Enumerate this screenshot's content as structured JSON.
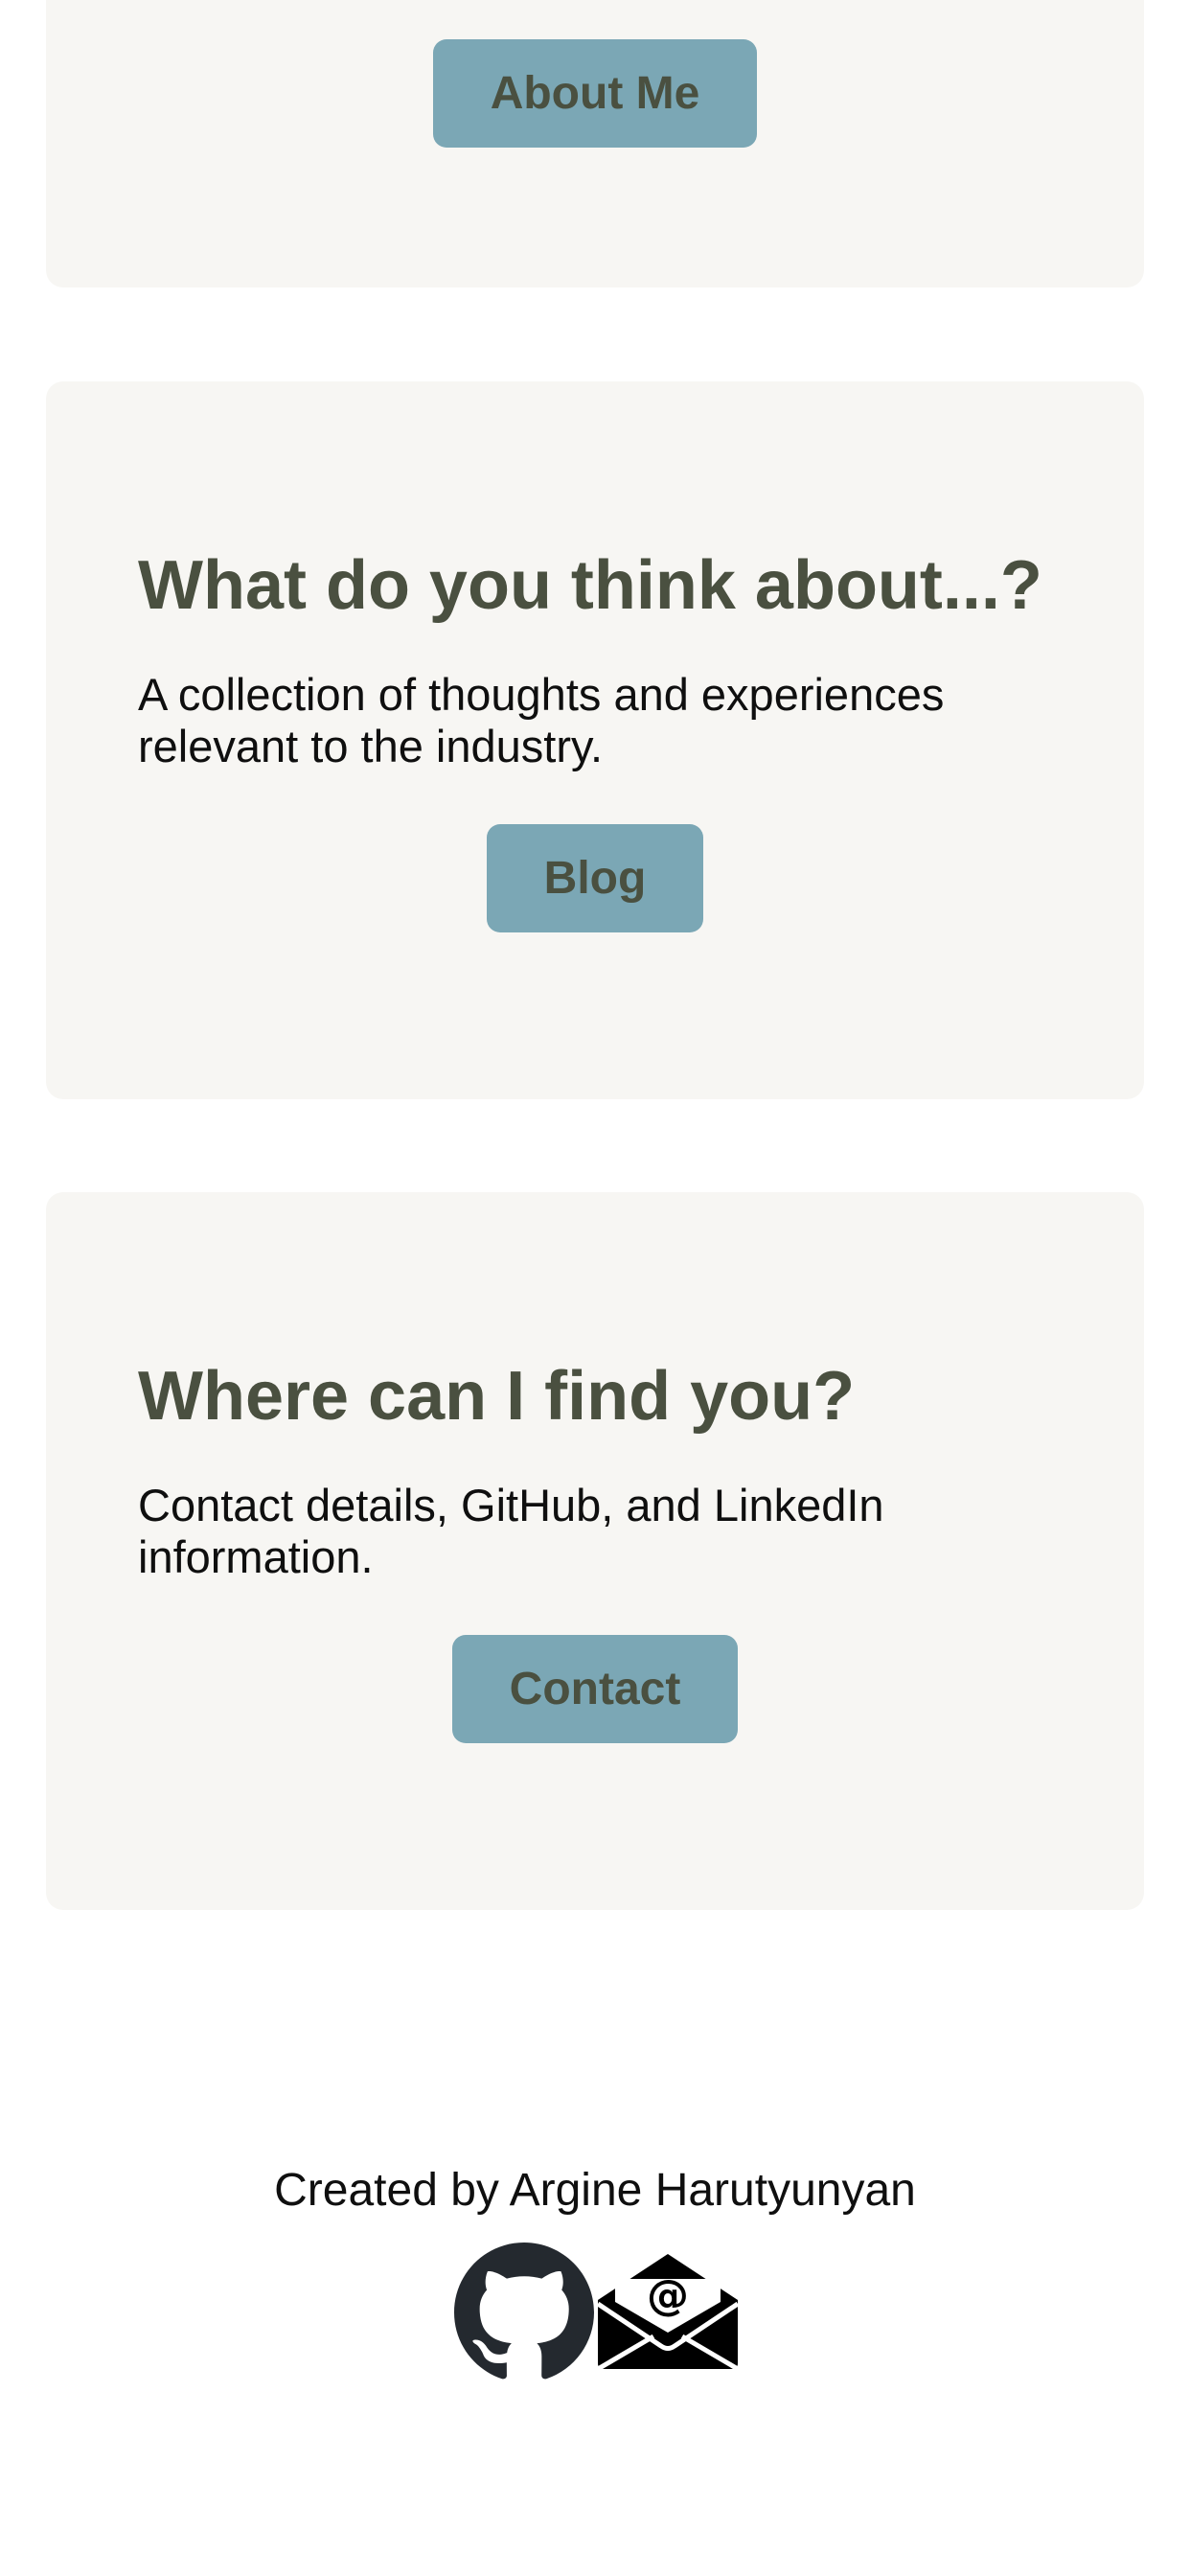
{
  "cards": {
    "about": {
      "button_label": "About Me"
    },
    "blog": {
      "title": "What do you think about...?",
      "description": "A collection of thoughts and experiences relevant to the industry.",
      "button_label": "Blog"
    },
    "contact": {
      "title": "Where can I find you?",
      "description": "Contact details, GitHub, and LinkedIn information.",
      "button_label": "Contact"
    }
  },
  "footer": {
    "credit": "Created by Argine Harutyunyan",
    "icons": [
      "github-icon",
      "email-icon"
    ]
  },
  "colors": {
    "card_background": "#f7f6f3",
    "button_background": "#7ba7b5",
    "heading_text": "#4a5040",
    "body_text": "#0f0f0f",
    "github_icon": "#24292f"
  }
}
